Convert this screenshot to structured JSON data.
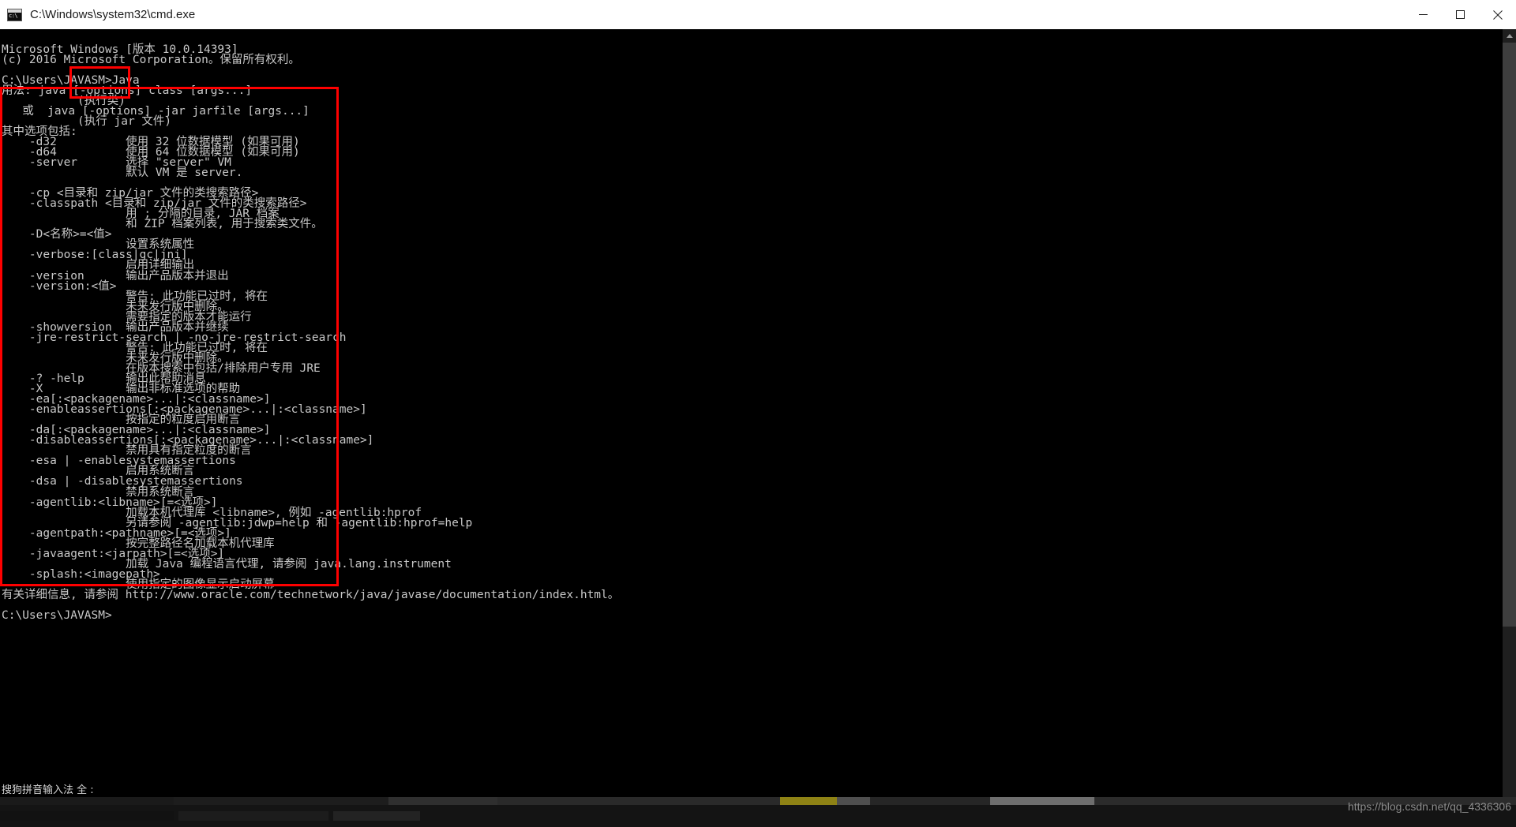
{
  "window": {
    "title": "C:\\Windows\\system32\\cmd.exe",
    "icon": "cmd-console-icon",
    "controls": {
      "minimize_label": "Minimize",
      "maximize_label": "Maximize",
      "close_label": "Close"
    }
  },
  "colors": {
    "titlebar_bg": "#ffffff",
    "titlebar_text": "#1b1b1b",
    "console_bg": "#000000",
    "console_text": "#c8c8c8",
    "annotation_red": "#fe0000",
    "scrollbar_track": "#1f1f1f",
    "scrollbar_thumb": "#3e3e3e",
    "taskbar_bg": "#141414",
    "watermark_text": "#8d8d8d"
  },
  "console": {
    "lines": [
      "Microsoft Windows [版本 10.0.14393]",
      "(c) 2016 Microsoft Corporation。保留所有权利。",
      "",
      "C:\\Users\\JAVASM>Java",
      "用法: java [-options] class [args...]",
      "           (执行类)",
      "   或  java [-options] -jar jarfile [args...]",
      "           (执行 jar 文件)",
      "其中选项包括:",
      "    -d32          使用 32 位数据模型 (如果可用)",
      "    -d64          使用 64 位数据模型 (如果可用)",
      "    -server       选择 \"server\" VM",
      "                  默认 VM 是 server.",
      "",
      "    -cp <目录和 zip/jar 文件的类搜索路径>",
      "    -classpath <目录和 zip/jar 文件的类搜索路径>",
      "                  用 ; 分隔的目录, JAR 档案",
      "                  和 ZIP 档案列表, 用于搜索类文件。",
      "    -D<名称>=<值>",
      "                  设置系统属性",
      "    -verbose:[class|gc|jni]",
      "                  启用详细输出",
      "    -version      输出产品版本并退出",
      "    -version:<值>",
      "                  警告: 此功能已过时, 将在",
      "                  未来发行版中删除。",
      "                  需要指定的版本才能运行",
      "    -showversion  输出产品版本并继续",
      "    -jre-restrict-search | -no-jre-restrict-search",
      "                  警告: 此功能已过时, 将在",
      "                  未来发行版中删除。",
      "                  在版本搜索中包括/排除用户专用 JRE",
      "    -? -help      输出此帮助消息",
      "    -X            输出非标准选项的帮助",
      "    -ea[:<packagename>...|:<classname>]",
      "    -enableassertions[:<packagename>...|:<classname>]",
      "                  按指定的粒度启用断言",
      "    -da[:<packagename>...|:<classname>]",
      "    -disableassertions[:<packagename>...|:<classname>]",
      "                  禁用具有指定粒度的断言",
      "    -esa | -enablesystemassertions",
      "                  启用系统断言",
      "    -dsa | -disablesystemassertions",
      "                  禁用系统断言",
      "    -agentlib:<libname>[=<选项>]",
      "                  加载本机代理库 <libname>, 例如 -agentlib:hprof",
      "                  另请参阅 -agentlib:jdwp=help 和 -agentlib:hprof=help",
      "    -agentpath:<pathname>[=<选项>]",
      "                  按完整路径名加载本机代理库",
      "    -javaagent:<jarpath>[=<选项>]",
      "                  加载 Java 编程语言代理, 请参阅 java.lang.instrument",
      "    -splash:<imagepath>",
      "                  使用指定的图像显示启动屏幕",
      "有关详细信息, 请参阅 http://www.oracle.com/technetwork/java/javase/documentation/index.html。",
      "",
      "C:\\Users\\JAVASM>"
    ]
  },
  "annotations": [
    {
      "id": "annot-options-token",
      "name": "highlight-options-token",
      "target": "-options"
    },
    {
      "id": "annot-big",
      "name": "highlight-java-options-list",
      "target": "其中选项包括"
    }
  ],
  "ime": {
    "label": "搜狗拼音输入法 全 :"
  },
  "watermark": {
    "text": "https://blog.csdn.net/qq_4336306"
  },
  "scrollbar": {
    "up_arrow": "scroll-up-arrow",
    "down_arrow": "scroll-down-arrow"
  }
}
